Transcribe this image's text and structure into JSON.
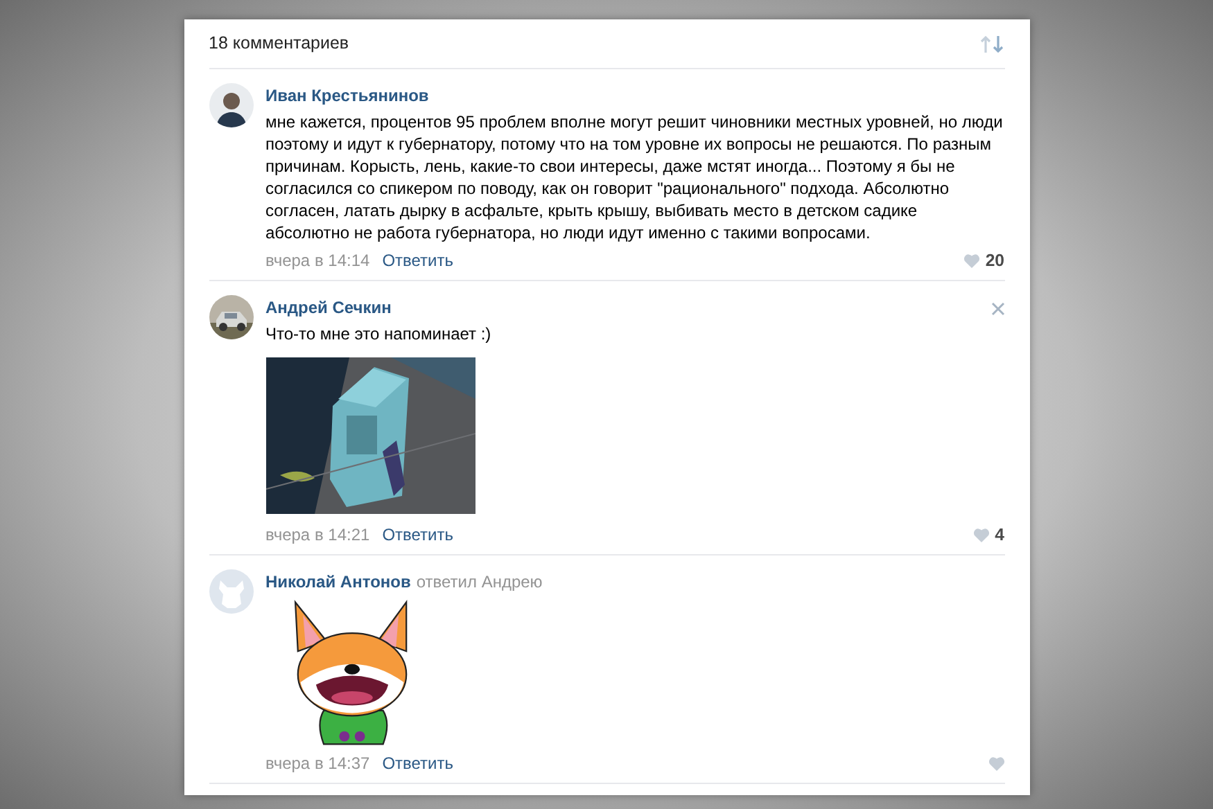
{
  "header": {
    "count_label": "18 комментариев"
  },
  "comments": [
    {
      "avatar": {
        "kind": "person"
      },
      "author": "Иван Крестьянинов",
      "text": "мне кажется, процентов 95 проблем вполне могут решит чиновники местных уровней, но люди поэтому и идут к губернатору, потому что на том уровне их вопросы не решаются. По разным причинам. Корысть, лень, какие-то свои интересы, даже мстят иногда... Поэтому я бы не согласился со спикером по поводу, как он говорит \"рационального\" подхода. Абсолютно согласен, латать дырку в асфальте, крыть крышу, выбивать место в детском садике абсолютно не работа губернатора, но люди идут именно с такими вопросами.",
      "time": "вчера в 14:14",
      "reply_label": "Ответить",
      "likes": "20",
      "liked": false,
      "closable": false
    },
    {
      "author": "Андрей Сечкин",
      "text": "Что-то мне это напоминает :)",
      "time": "вчера в 14:21",
      "reply_label": "Ответить",
      "likes": "4",
      "liked": false,
      "closable": true
    },
    {
      "avatar": {
        "kind": "default"
      },
      "author": "Николай Антонов",
      "reply_to": "ответил Андрею",
      "attachment": {
        "kind": "sticker"
      },
      "time": "вчера в 14:37",
      "reply_label": "Ответить",
      "liked": false,
      "closable": false
    }
  ]
}
